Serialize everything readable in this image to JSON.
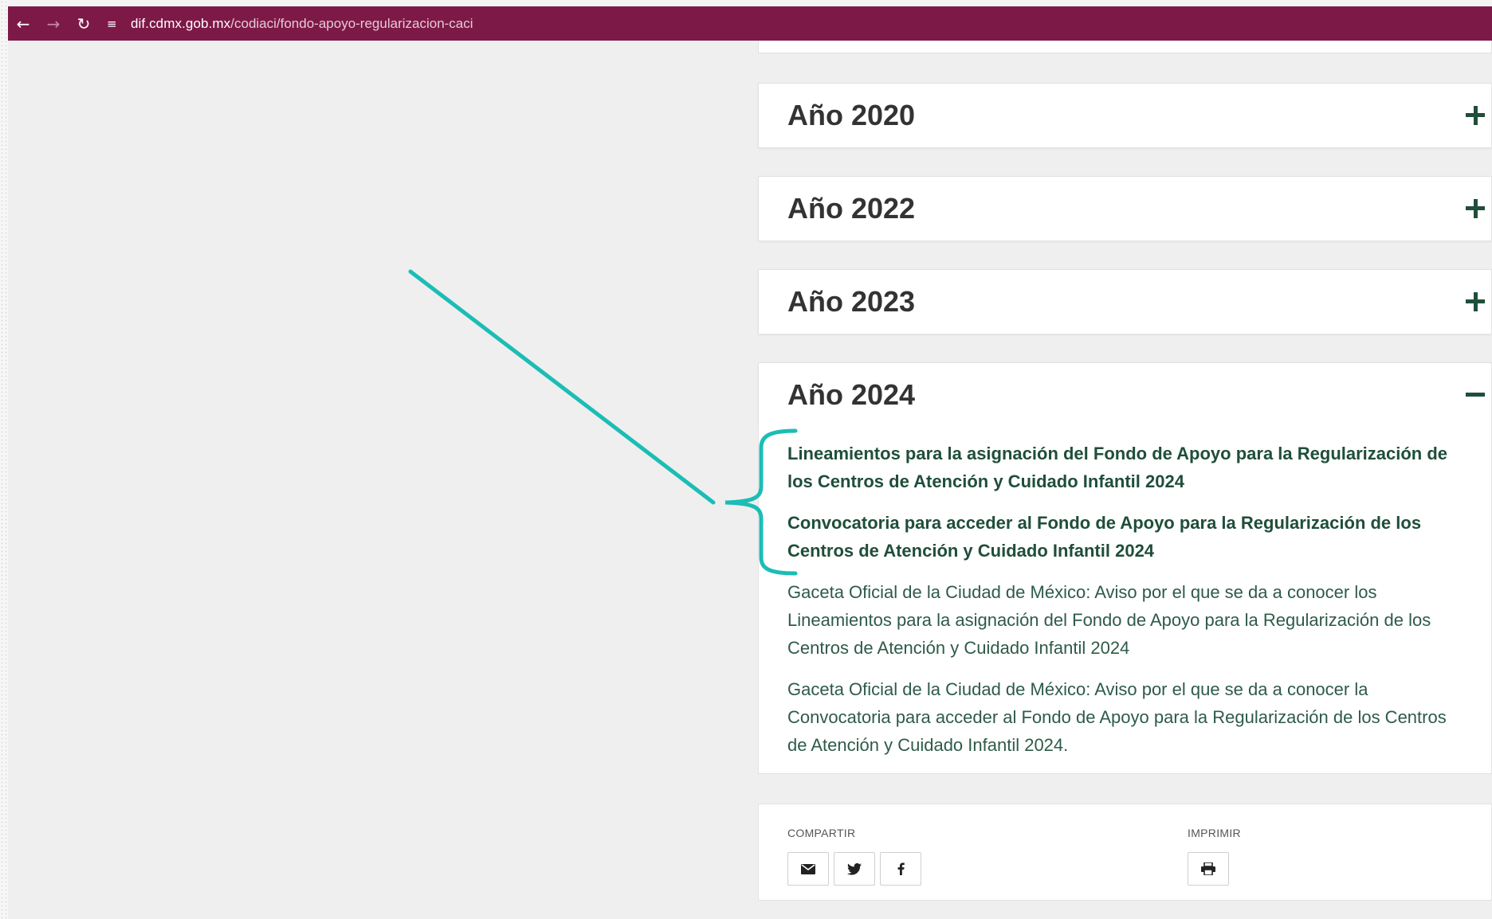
{
  "browser": {
    "url_host": "dif.cdmx.gob.mx",
    "url_path": "/codiaci/fondo-apoyo-regularizacion-caci"
  },
  "accordion": [
    {
      "title": "Año 2020",
      "state": "collapsed",
      "icon": "plus-icon"
    },
    {
      "title": "Año 2022",
      "state": "collapsed",
      "icon": "plus-icon"
    },
    {
      "title": "Año 2023",
      "state": "collapsed",
      "icon": "plus-icon"
    },
    {
      "title": "Año 2024",
      "state": "expanded",
      "icon": "minus-icon"
    }
  ],
  "docs_2024": {
    "link1": {
      "line1": "Lineamientos para la asignación del Fondo de Apoyo para la Regularización de",
      "line2": "los Centros de Atención y Cuidado Infantil 2024"
    },
    "link2": {
      "line1": "Convocatoria para acceder al Fondo de Apoyo para la Regularización de los",
      "line2": "Centros de Atención y Cuidado Infantil 2024"
    },
    "link3": {
      "line1": "Gaceta Oficial de la Ciudad de México: Aviso por el que se da a conocer los",
      "line2": "Lineamientos para la asignación del Fondo de Apoyo para la Regularización de los",
      "line3": "Centros de Atención y Cuidado Infantil 2024"
    },
    "link4": {
      "line1": "Gaceta Oficial de la Ciudad de México: Aviso por el que se da a conocer la",
      "line2": "Convocatoria para acceder al Fondo de Apoyo para la Regularización de los Centros",
      "line3": "de Atención y Cuidado Infantil 2024."
    }
  },
  "share": {
    "compartir_label": "COMPARTIR",
    "imprimir_label": "IMPRIMIR",
    "buttons": [
      "email-icon",
      "twitter-icon",
      "facebook-icon"
    ],
    "print_button": "print-icon"
  },
  "colors": {
    "browser_bar": "#7d1947",
    "accent_green": "#1f4e3a",
    "annotation_teal": "#1bbdb5"
  }
}
